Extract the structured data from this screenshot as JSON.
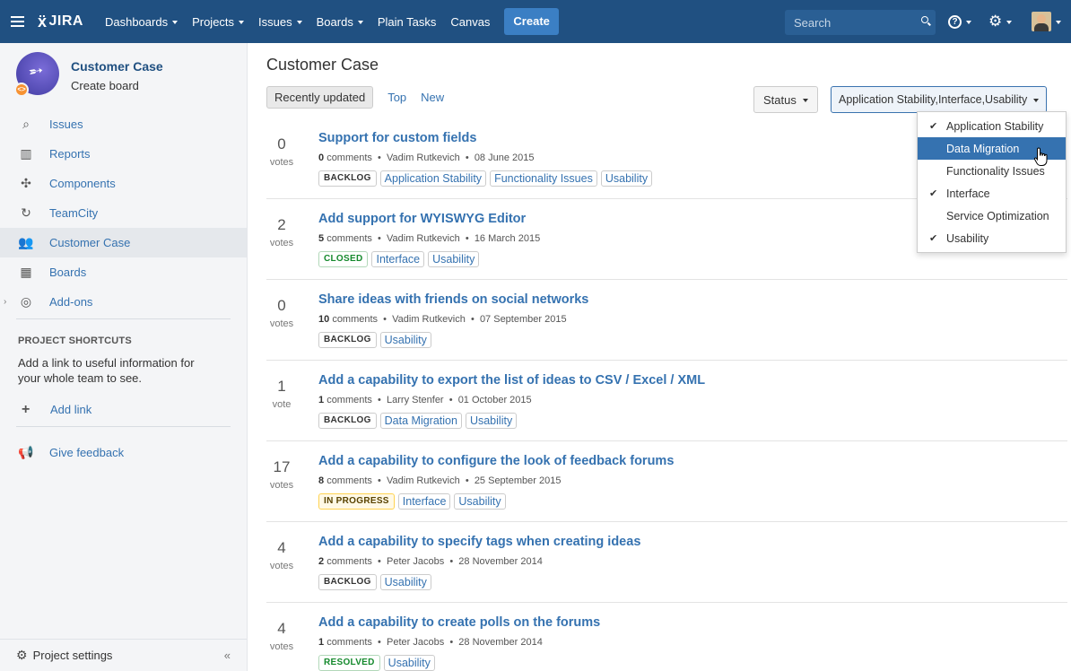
{
  "topbar": {
    "logo": "JIRA",
    "nav": [
      {
        "label": "Dashboards",
        "dropdown": true
      },
      {
        "label": "Projects",
        "dropdown": true
      },
      {
        "label": "Issues",
        "dropdown": true
      },
      {
        "label": "Boards",
        "dropdown": true
      },
      {
        "label": "Plain Tasks",
        "dropdown": false
      },
      {
        "label": "Canvas",
        "dropdown": false
      }
    ],
    "create_label": "Create",
    "search_placeholder": "Search",
    "brand_color": "#205081"
  },
  "sidebar": {
    "project_name": "Customer Case",
    "project_sub": "Create board",
    "items": [
      {
        "label": "Issues",
        "icon": "search-list-icon"
      },
      {
        "label": "Reports",
        "icon": "chart-bars-icon"
      },
      {
        "label": "Components",
        "icon": "puzzle-icon"
      },
      {
        "label": "TeamCity",
        "icon": "refresh-icon"
      },
      {
        "label": "Customer Case",
        "icon": "users-icon",
        "active": true
      },
      {
        "label": "Boards",
        "icon": "board-icon"
      },
      {
        "label": "Add-ons",
        "icon": "addon-icon"
      }
    ],
    "shortcuts_title": "PROJECT SHORTCUTS",
    "shortcuts_desc": "Add a link to useful information for your whole team to see.",
    "add_link": "Add link",
    "give_feedback": "Give feedback",
    "project_settings": "Project settings",
    "collapse": "«"
  },
  "main": {
    "title": "Customer Case",
    "tabs": [
      "Recently updated",
      "Top",
      "New"
    ],
    "status_filter": "Status",
    "category_filter": "Application Stability,Interface,Usability",
    "ideas": [
      {
        "votes": "0",
        "vote_label": "votes",
        "title": "Support for custom fields",
        "comments": "0",
        "comments_label": "comments",
        "author": "Vadim Rutkevich",
        "date": "08 June 2015",
        "status": "BACKLOG",
        "status_class": "backlog",
        "tags": [
          "Application Stability",
          "Functionality Issues",
          "Usability"
        ]
      },
      {
        "votes": "2",
        "vote_label": "votes",
        "title": "Add support for WYISWYG Editor",
        "comments": "5",
        "comments_label": "comments",
        "author": "Vadim Rutkevich",
        "date": "16 March 2015",
        "status": "CLOSED",
        "status_class": "closed",
        "tags": [
          "Interface",
          "Usability"
        ]
      },
      {
        "votes": "0",
        "vote_label": "votes",
        "title": "Share ideas with friends on social networks",
        "comments": "10",
        "comments_label": "comments",
        "author": "Vadim Rutkevich",
        "date": "07 September 2015",
        "status": "BACKLOG",
        "status_class": "backlog",
        "tags": [
          "Usability"
        ]
      },
      {
        "votes": "1",
        "vote_label": "vote",
        "title": "Add a capability to export the list of ideas to CSV / Excel / XML",
        "comments": "1",
        "comments_label": "comments",
        "author": "Larry Stenfer",
        "date": "01 October 2015",
        "status": "BACKLOG",
        "status_class": "backlog",
        "tags": [
          "Data Migration",
          "Usability"
        ]
      },
      {
        "votes": "17",
        "vote_label": "votes",
        "title": "Add a capability to configure the look of feedback forums",
        "comments": "8",
        "comments_label": "comments",
        "author": "Vadim Rutkevich",
        "date": "25 September 2015",
        "status": "IN PROGRESS",
        "status_class": "inprogress",
        "tags": [
          "Interface",
          "Usability"
        ]
      },
      {
        "votes": "4",
        "vote_label": "votes",
        "title": "Add a capability to specify tags when creating ideas",
        "comments": "2",
        "comments_label": "comments",
        "author": "Peter Jacobs",
        "date": "28 November 2014",
        "status": "BACKLOG",
        "status_class": "backlog",
        "tags": [
          "Usability"
        ]
      },
      {
        "votes": "4",
        "vote_label": "votes",
        "title": "Add a capability to create polls on the forums",
        "comments": "1",
        "comments_label": "comments",
        "author": "Peter Jacobs",
        "date": "28 November 2014",
        "status": "RESOLVED",
        "status_class": "resolved",
        "tags": [
          "Usability"
        ]
      }
    ]
  },
  "dropdown": {
    "items": [
      {
        "label": "Application Stability",
        "checked": true,
        "highlighted": false
      },
      {
        "label": "Data Migration",
        "checked": false,
        "highlighted": true
      },
      {
        "label": "Functionality Issues",
        "checked": false,
        "highlighted": false
      },
      {
        "label": "Interface",
        "checked": true,
        "highlighted": false
      },
      {
        "label": "Service Optimization",
        "checked": false,
        "highlighted": false
      },
      {
        "label": "Usability",
        "checked": true,
        "highlighted": false
      }
    ],
    "check_glyph": "✔"
  }
}
